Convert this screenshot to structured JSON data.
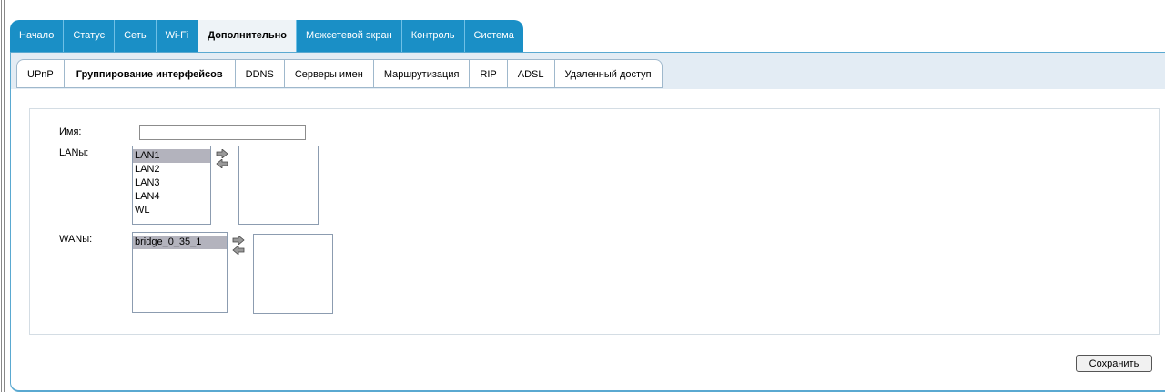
{
  "top_nav": {
    "tabs": [
      {
        "label": "Начало"
      },
      {
        "label": "Статус"
      },
      {
        "label": "Сеть"
      },
      {
        "label": "Wi-Fi"
      },
      {
        "label": "Дополнительно"
      },
      {
        "label": "Межсетевой экран"
      },
      {
        "label": "Контроль"
      },
      {
        "label": "Система"
      }
    ],
    "active_index": 4
  },
  "sub_nav": {
    "tabs": [
      {
        "label": "UPnP"
      },
      {
        "label": "Группирование интерфейсов"
      },
      {
        "label": "DDNS"
      },
      {
        "label": "Серверы имен"
      },
      {
        "label": "Маршрутизация"
      },
      {
        "label": "RIP"
      },
      {
        "label": "ADSL"
      },
      {
        "label": "Удаленный доступ"
      }
    ],
    "active_index": 1
  },
  "form": {
    "name_label": "Имя:",
    "name_value": "",
    "lans_label": "LANы:",
    "lans_available": [
      "LAN1",
      "LAN2",
      "LAN3",
      "LAN4",
      "WL"
    ],
    "lans_selected_option": "LAN1",
    "lans_grouped": [],
    "wans_label": "WANы:",
    "wans_available": [
      "bridge_0_35_1"
    ],
    "wans_selected_option": "bridge_0_35_1",
    "wans_grouped": []
  },
  "actions": {
    "save_label": "Сохранить"
  },
  "colors": {
    "tab_blue": "#1a8fc6",
    "subbar_bg": "#e3ecf4",
    "selected_option": "#b3b3bd"
  },
  "icons": {
    "move_right": "arrow-right-icon",
    "move_left": "arrow-left-icon"
  }
}
